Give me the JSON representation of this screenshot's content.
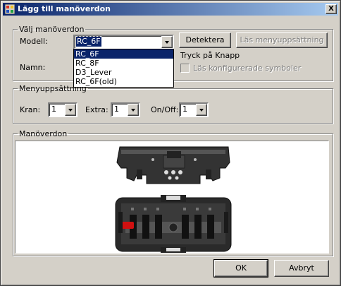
{
  "window": {
    "title": "Lägg till manöverdon",
    "close_glyph": "X"
  },
  "select_group": {
    "legend": "Välj manöverdon",
    "model_label": "Modell:",
    "model_value": "RC_6F",
    "name_label": "Namn:",
    "detect_button": "Detektera",
    "read_menu_button": "Läs menyuppsättning",
    "press_button_text": "Tryck på Knapp",
    "read_symbols_label": "Läs konfigurerade symboler",
    "model_options": [
      "RC_6F",
      "RC_8F",
      "D3_Lever",
      "RC_6F(old)"
    ]
  },
  "menu_group": {
    "legend": "Menyuppsättning",
    "crane_label": "Kran:",
    "crane_value": "1",
    "extra_label": "Extra:",
    "extra_value": "1",
    "onoff_label": "On/Off:",
    "onoff_value": "1"
  },
  "controller_group": {
    "legend": "Manöverdon"
  },
  "buttons": {
    "ok": "OK",
    "cancel": "Avbryt"
  },
  "colors": {
    "title_start": "#0a246a",
    "title_end": "#a6caf0",
    "face": "#d4d0c8",
    "highlight": "#0a246a",
    "lever_red": "#d01010"
  }
}
